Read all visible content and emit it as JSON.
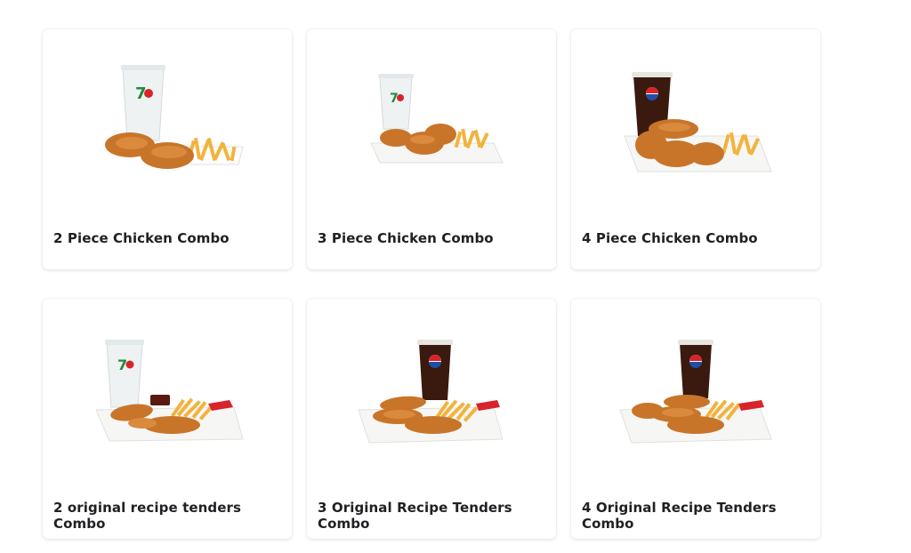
{
  "products": [
    {
      "name": "2 Piece Chicken Combo",
      "drink": "7up",
      "pieces": 2,
      "style": "bone-in"
    },
    {
      "name": "3 Piece Chicken Combo",
      "drink": "7up",
      "pieces": 3,
      "style": "bone-in"
    },
    {
      "name": "4 Piece Chicken Combo",
      "drink": "pepsi",
      "pieces": 4,
      "style": "bone-in"
    },
    {
      "name": "2 original recipe tenders Combo",
      "drink": "7up",
      "pieces": 2,
      "style": "tenders"
    },
    {
      "name": "3 Original Recipe Tenders Combo",
      "drink": "pepsi",
      "pieces": 3,
      "style": "tenders"
    },
    {
      "name": "4 Original Recipe Tenders Combo",
      "drink": "pepsi",
      "pieces": 4,
      "style": "tenders"
    }
  ],
  "colors": {
    "fried_chicken": "#c8752a",
    "fries": "#f2b33d",
    "cola": "#3a1a0e",
    "clear_cup": "#eef2f3",
    "sevenup_green": "#1d8a3a",
    "sevenup_red": "#d8232a",
    "pepsi_blue": "#1f4fa5",
    "title_text": "#202124"
  }
}
